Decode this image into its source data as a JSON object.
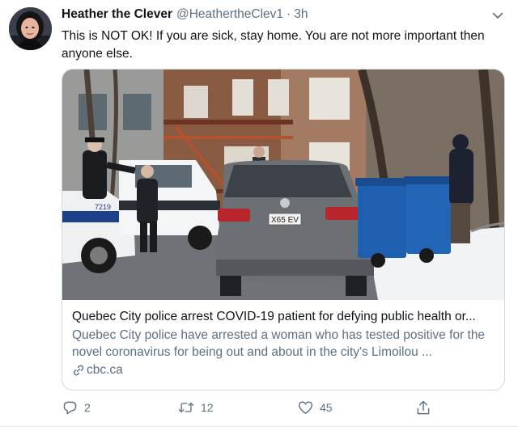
{
  "tweet": {
    "author_name": "Heather the Clever",
    "author_handle": "@HeathertheClev1",
    "separator": "·",
    "time": "3h",
    "text": "This is NOT OK! If you are sick, stay home. You are not more important then anyone else."
  },
  "card": {
    "title": "Quebec City police arrest COVID-19 patient for defying public health or...",
    "description": "Quebec City police have arrested a woman who has tested positive for the novel coronavirus for being out and about in the city's Limoilou ...",
    "domain": "cbc.ca",
    "image_plate_text": "X65 EV",
    "image_vehicle_number": "7219"
  },
  "actions": {
    "reply_count": "2",
    "retweet_count": "12",
    "like_count": "45"
  },
  "icons": {
    "reply": "reply-icon",
    "retweet": "retweet-icon",
    "like": "heart-icon",
    "share": "share-icon",
    "more": "chevron-down-icon",
    "link": "link-icon"
  },
  "colors": {
    "text": "#0f1419",
    "secondary": "#5b7083",
    "border": "#cfd9de"
  }
}
